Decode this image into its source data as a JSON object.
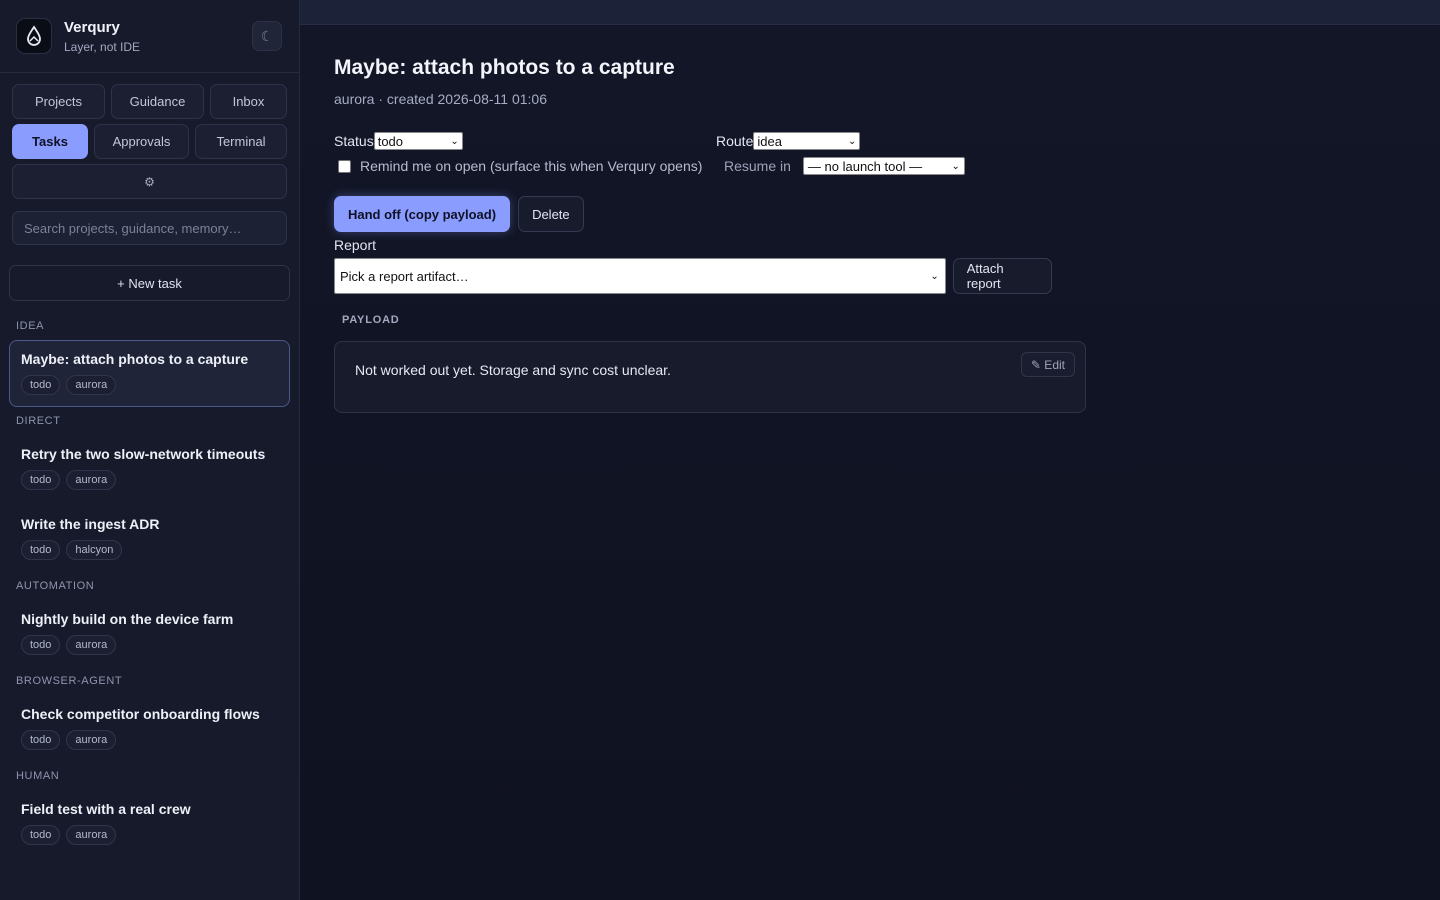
{
  "brand": {
    "name": "Verqury",
    "tagline": "Layer, not IDE"
  },
  "theme_toggle": "☾",
  "nav": {
    "projects": "Projects",
    "guidance": "Guidance",
    "inbox": "Inbox",
    "tasks": "Tasks",
    "approvals": "Approvals",
    "terminal": "Terminal",
    "settings": "⚙"
  },
  "search": {
    "placeholder": "Search projects, guidance, memory…"
  },
  "new_task": "+ New task",
  "groups": [
    {
      "label": "IDEA",
      "tasks": [
        {
          "title": "Maybe: attach photos to a capture",
          "status": "todo",
          "project": "aurora"
        }
      ]
    },
    {
      "label": "DIRECT",
      "tasks": [
        {
          "title": "Retry the two slow-network timeouts",
          "status": "todo",
          "project": "aurora"
        },
        {
          "title": "Write the ingest ADR",
          "status": "todo",
          "project": "halcyon"
        }
      ]
    },
    {
      "label": "AUTOMATION",
      "tasks": [
        {
          "title": "Nightly build on the device farm",
          "status": "todo",
          "project": "aurora"
        }
      ]
    },
    {
      "label": "BROWSER-AGENT",
      "tasks": [
        {
          "title": "Check competitor onboarding flows",
          "status": "todo",
          "project": "aurora"
        }
      ]
    },
    {
      "label": "HUMAN",
      "tasks": [
        {
          "title": "Field test with a real crew",
          "status": "todo",
          "project": "aurora"
        }
      ]
    }
  ],
  "detail": {
    "title": "Maybe: attach photos to a capture",
    "meta": "aurora · created 2026-08-11 01:06",
    "status_label": "Status",
    "status_value": "todo",
    "route_label": "Route",
    "route_value": "idea",
    "remind_label": "Remind me on open (surface this when Verqury opens)",
    "resume_label": "Resume in",
    "resume_value": "— no launch tool —",
    "handoff_label": "Hand off (copy payload)",
    "delete_label": "Delete",
    "report_label": "Report",
    "report_placeholder": "Pick a report artifact…",
    "attach_label": "Attach report",
    "payload_label": "PAYLOAD",
    "payload_text": "Not worked out yet. Storage and sync cost unclear.",
    "edit_label": "✎ Edit"
  },
  "colors": {
    "accent": "#8b9cff",
    "bg": "#10131f",
    "sidebar": "#161a2b"
  }
}
